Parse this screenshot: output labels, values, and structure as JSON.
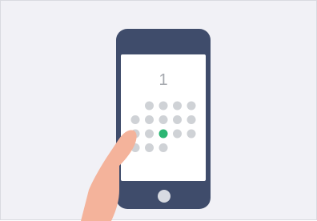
{
  "display": {
    "number": "1"
  },
  "pattern_grid": {
    "active_color": "#2bb673",
    "inactive_color": "#cfd2d6",
    "rows": [
      {
        "dots": [
          {
            "state": "hidden"
          },
          {
            "state": "off"
          },
          {
            "state": "off"
          },
          {
            "state": "off"
          },
          {
            "state": "off"
          }
        ]
      },
      {
        "dots": [
          {
            "state": "off"
          },
          {
            "state": "off"
          },
          {
            "state": "off"
          },
          {
            "state": "off"
          },
          {
            "state": "off"
          }
        ]
      },
      {
        "dots": [
          {
            "state": "off"
          },
          {
            "state": "off"
          },
          {
            "state": "active"
          },
          {
            "state": "off"
          },
          {
            "state": "off"
          }
        ]
      },
      {
        "dots": [
          {
            "state": "off"
          },
          {
            "state": "off"
          },
          {
            "state": "off"
          },
          {
            "state": "hidden"
          },
          {
            "state": "hidden"
          }
        ]
      }
    ]
  },
  "colors": {
    "phone_body": "#3f4c6b",
    "hand": "#f4b39b",
    "background": "#f1f1f6"
  }
}
